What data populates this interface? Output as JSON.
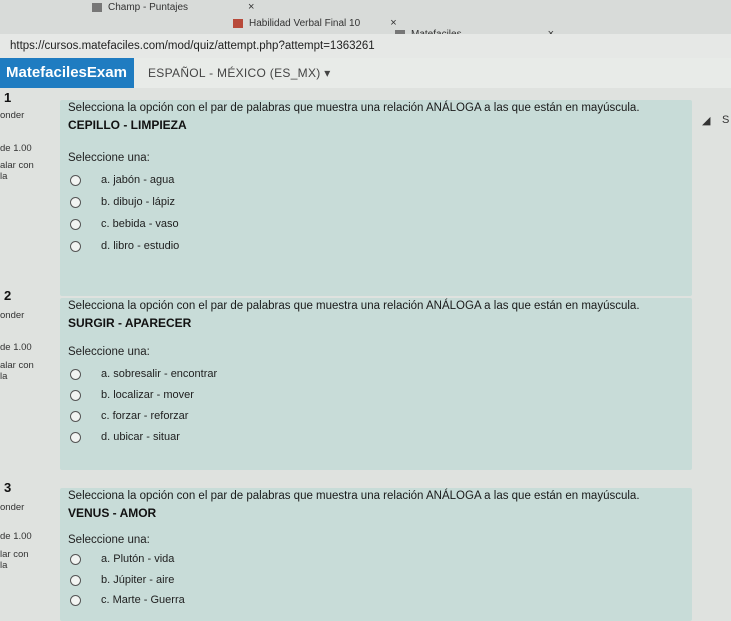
{
  "browser": {
    "tabs": [
      {
        "label": "Champ - Puntajes",
        "close": "×"
      },
      {
        "label": "Habilidad Verbal Final 10",
        "close": "×"
      },
      {
        "label": "Matefaciles",
        "close": "×"
      }
    ],
    "new_tab": "+",
    "url": "https://cursos.matefaciles.com/mod/quiz/attempt.php?attempt=1363261"
  },
  "site": {
    "brand": "MatefacilesExam",
    "language": "ESPAÑOL - MÉXICO (ES_MX) ▾"
  },
  "questions": [
    {
      "number": "1",
      "side_status": "onder",
      "side_points": "de 1.00",
      "side_flag_1": "alar con",
      "side_flag_2": "la",
      "prompt": "Selecciona la opción con el par de palabras que muestra una relación ANÁLOGA a las que están en mayúscula.",
      "pair": "CEPILLO - LIMPIEZA",
      "select_label": "Seleccione una:",
      "options": [
        "a. jabón - agua",
        "b. dibujo - lápiz",
        "c. bebida - vaso",
        "d. libro - estudio"
      ]
    },
    {
      "number": "2",
      "side_status": "onder",
      "side_points": "de 1.00",
      "side_flag_1": "alar con",
      "side_flag_2": "la",
      "prompt": "Selecciona la opción con el par de palabras que muestra una relación ANÁLOGA a las que están en mayúscula.",
      "pair": "SURGIR - APARECER",
      "select_label": "Seleccione una:",
      "options": [
        "a. sobresalir - encontrar",
        "b. localizar - mover",
        "c. forzar - reforzar",
        "d. ubicar - situar"
      ]
    },
    {
      "number": "3",
      "side_status": "onder",
      "side_points": "de 1.00",
      "side_flag_1": "lar con",
      "side_flag_2": "la",
      "prompt": "Selecciona la opción con el par de palabras que muestra una relación ANÁLOGA a las que están en mayúscula.",
      "pair": "VENUS - AMOR",
      "select_label": "Seleccione una:",
      "options": [
        "a. Plutón - vida",
        "b. Júpiter - aire",
        "c. Marte - Guerra"
      ]
    }
  ],
  "right_side": {
    "s_label": "S"
  }
}
